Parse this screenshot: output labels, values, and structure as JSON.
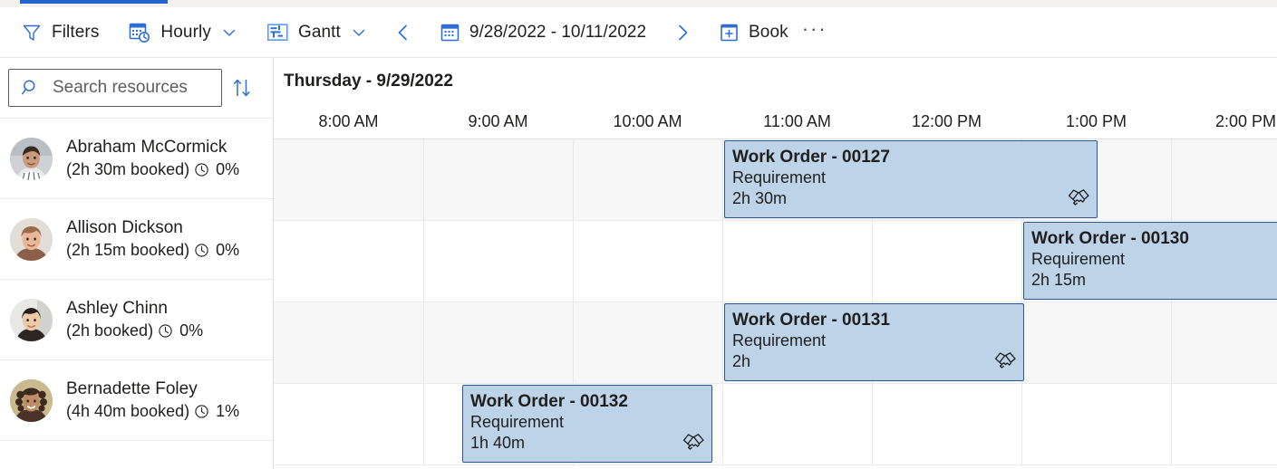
{
  "theme": {
    "accent": "#2564cf",
    "icon_blue": "#2b6fd4",
    "card_fill": "#bcd3e8",
    "card_border": "#2b579a",
    "row_alt": "#f7f7f7",
    "text": "#201f1e"
  },
  "toolbar": {
    "filters_label": "Filters",
    "filters_icon": "filter-icon",
    "view_mode_label": "Hourly",
    "view_mode_icon": "calendar-clock-icon",
    "view_mode_caret": "chevron-down-icon",
    "gantt_label": "Gantt",
    "gantt_icon": "gantt-icon",
    "gantt_caret": "chevron-down-icon",
    "prev_icon": "chevron-left-icon",
    "next_icon": "chevron-right-icon",
    "date_range": "9/28/2022 - 10/11/2022",
    "date_icon": "calendar-icon",
    "book_label": "Book",
    "book_icon": "calendar-add-icon",
    "overflow_label": "···"
  },
  "left_panel": {
    "search": {
      "placeholder": "Search resources",
      "value": "",
      "icon": "search-icon"
    },
    "sort_icon": "sort-updown-icon",
    "resources": [
      {
        "name": "Abraham McCormick",
        "booked": "(2h 30m booked)",
        "utilization": "0%",
        "clock_icon": "clock-icon"
      },
      {
        "name": "Allison Dickson",
        "booked": "(2h 15m booked)",
        "utilization": "0%",
        "clock_icon": "clock-icon"
      },
      {
        "name": "Ashley Chinn",
        "booked": "(2h booked)",
        "utilization": "0%",
        "clock_icon": "clock-icon"
      },
      {
        "name": "Bernadette Foley",
        "booked": "(4h 40m booked)",
        "utilization": "1%",
        "clock_icon": "clock-icon"
      }
    ]
  },
  "schedule": {
    "day_title": "Thursday - 9/29/2022",
    "time_ticks": [
      "8:00 AM",
      "9:00 AM",
      "10:00 AM",
      "11:00 AM",
      "12:00 PM",
      "1:00 PM",
      "2:00 PM"
    ],
    "bookings": [
      {
        "title": "Work Order - 00127",
        "type": "Requirement",
        "duration": "2h 30m",
        "row": 0,
        "icon": "handshake-icon",
        "show_icon": true
      },
      {
        "title": "Work Order - 00130",
        "type": "Requirement",
        "duration": "2h 15m",
        "row": 1,
        "icon": "handshake-icon",
        "show_icon": false
      },
      {
        "title": "Work Order - 00131",
        "type": "Requirement",
        "duration": "2h",
        "row": 2,
        "icon": "handshake-icon",
        "show_icon": true
      },
      {
        "title": "Work Order - 00132",
        "type": "Requirement",
        "duration": "1h 40m",
        "row": 3,
        "icon": "handshake-icon",
        "show_icon": true
      }
    ]
  }
}
